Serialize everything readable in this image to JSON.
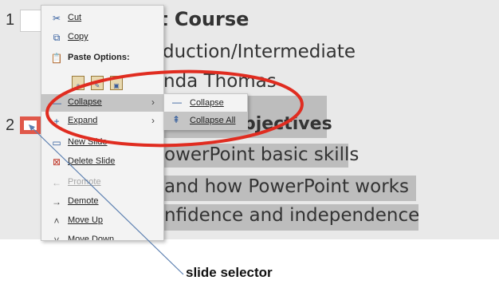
{
  "outline": {
    "slide1_number": "1",
    "slide1_title": "t Course",
    "slide1_line2": "duction/Intermediate",
    "slide1_line3": "nda Thomas",
    "slide2_number": "2",
    "slide2_title": "bjectives",
    "slide2_line2": "owerPoint basic skills",
    "slide2_line3": "and how PowerPoint works",
    "slide2_line4": "nfidence and independence"
  },
  "context_menu": {
    "cut": "Cut",
    "copy": "Copy",
    "paste_options": "Paste Options:",
    "collapse": "Collapse",
    "expand": "Expand",
    "new_slide": "New Slide",
    "delete_slide": "Delete Slide",
    "promote": "Promote",
    "demote": "Demote",
    "move_up": "Move Up",
    "move_down": "Move Down"
  },
  "submenu": {
    "collapse": "Collapse",
    "collapse_all": "Collapse All"
  },
  "annotation": {
    "label": "slide selector"
  },
  "colors": {
    "highlight_oval": "#e02c20",
    "selector_box": "#e0584a",
    "pointer_line": "#5b7fb0",
    "menu_highlight": "#c5c5c5",
    "selection": "#bdbdbd"
  },
  "icons": {
    "cut": "scissors-icon",
    "copy": "copy-icon",
    "paste": "clipboard-icon",
    "collapse": "minus-icon",
    "expand": "plus-icon",
    "new_slide": "new-slide-icon",
    "delete_slide": "delete-slide-icon",
    "promote": "arrow-left-icon",
    "demote": "arrow-right-icon",
    "move_up": "chevron-up-icon",
    "move_down": "chevron-down-icon",
    "collapse_all": "collapse-all-icon"
  }
}
